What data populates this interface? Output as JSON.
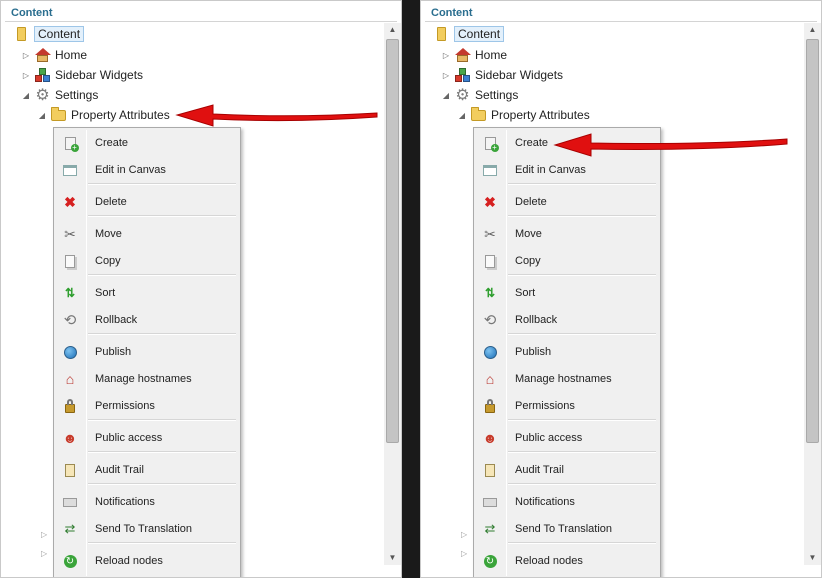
{
  "colors": {
    "accent": "#2a6e8f",
    "arrow": "#e01010",
    "selection": "#e3f0fb",
    "folder": "#f2cd5e"
  },
  "panels": [
    {
      "title": "Content",
      "tree": {
        "root": {
          "label": "Content",
          "icon": "folder-icon"
        },
        "home": {
          "label": "Home",
          "icon": "home-icon"
        },
        "widgets": {
          "label": "Sidebar Widgets",
          "icon": "widgets-icon"
        },
        "settings": {
          "label": "Settings",
          "icon": "gear-icon"
        },
        "property": {
          "label": "Property Attributes",
          "icon": "folder-icon"
        }
      },
      "annotation_target": "Property Attributes"
    },
    {
      "title": "Content",
      "tree": {
        "root": {
          "label": "Content",
          "icon": "folder-icon"
        },
        "home": {
          "label": "Home",
          "icon": "home-icon"
        },
        "widgets": {
          "label": "Sidebar Widgets",
          "icon": "widgets-icon"
        },
        "settings": {
          "label": "Settings",
          "icon": "gear-icon"
        },
        "property": {
          "label": "Property Attributes",
          "icon": "folder-icon"
        }
      },
      "annotation_target": "Create"
    }
  ],
  "menu": {
    "items": [
      {
        "label": "Create",
        "icon": "create-icon"
      },
      {
        "label": "Edit in Canvas",
        "icon": "canvas-icon"
      },
      {
        "label": "Delete",
        "icon": "delete-icon"
      },
      {
        "label": "Move",
        "icon": "scissors-icon"
      },
      {
        "label": "Copy",
        "icon": "copy-icon"
      },
      {
        "label": "Sort",
        "icon": "sort-icon"
      },
      {
        "label": "Rollback",
        "icon": "rollback-icon"
      },
      {
        "label": "Publish",
        "icon": "globe-icon"
      },
      {
        "label": "Manage hostnames",
        "icon": "hostnames-icon"
      },
      {
        "label": "Permissions",
        "icon": "lock-icon"
      },
      {
        "label": "Public access",
        "icon": "user-icon"
      },
      {
        "label": "Audit Trail",
        "icon": "clipboard-icon"
      },
      {
        "label": "Notifications",
        "icon": "notifications-icon"
      },
      {
        "label": "Send To Translation",
        "icon": "translation-icon"
      },
      {
        "label": "Reload nodes",
        "icon": "reload-icon"
      }
    ]
  }
}
